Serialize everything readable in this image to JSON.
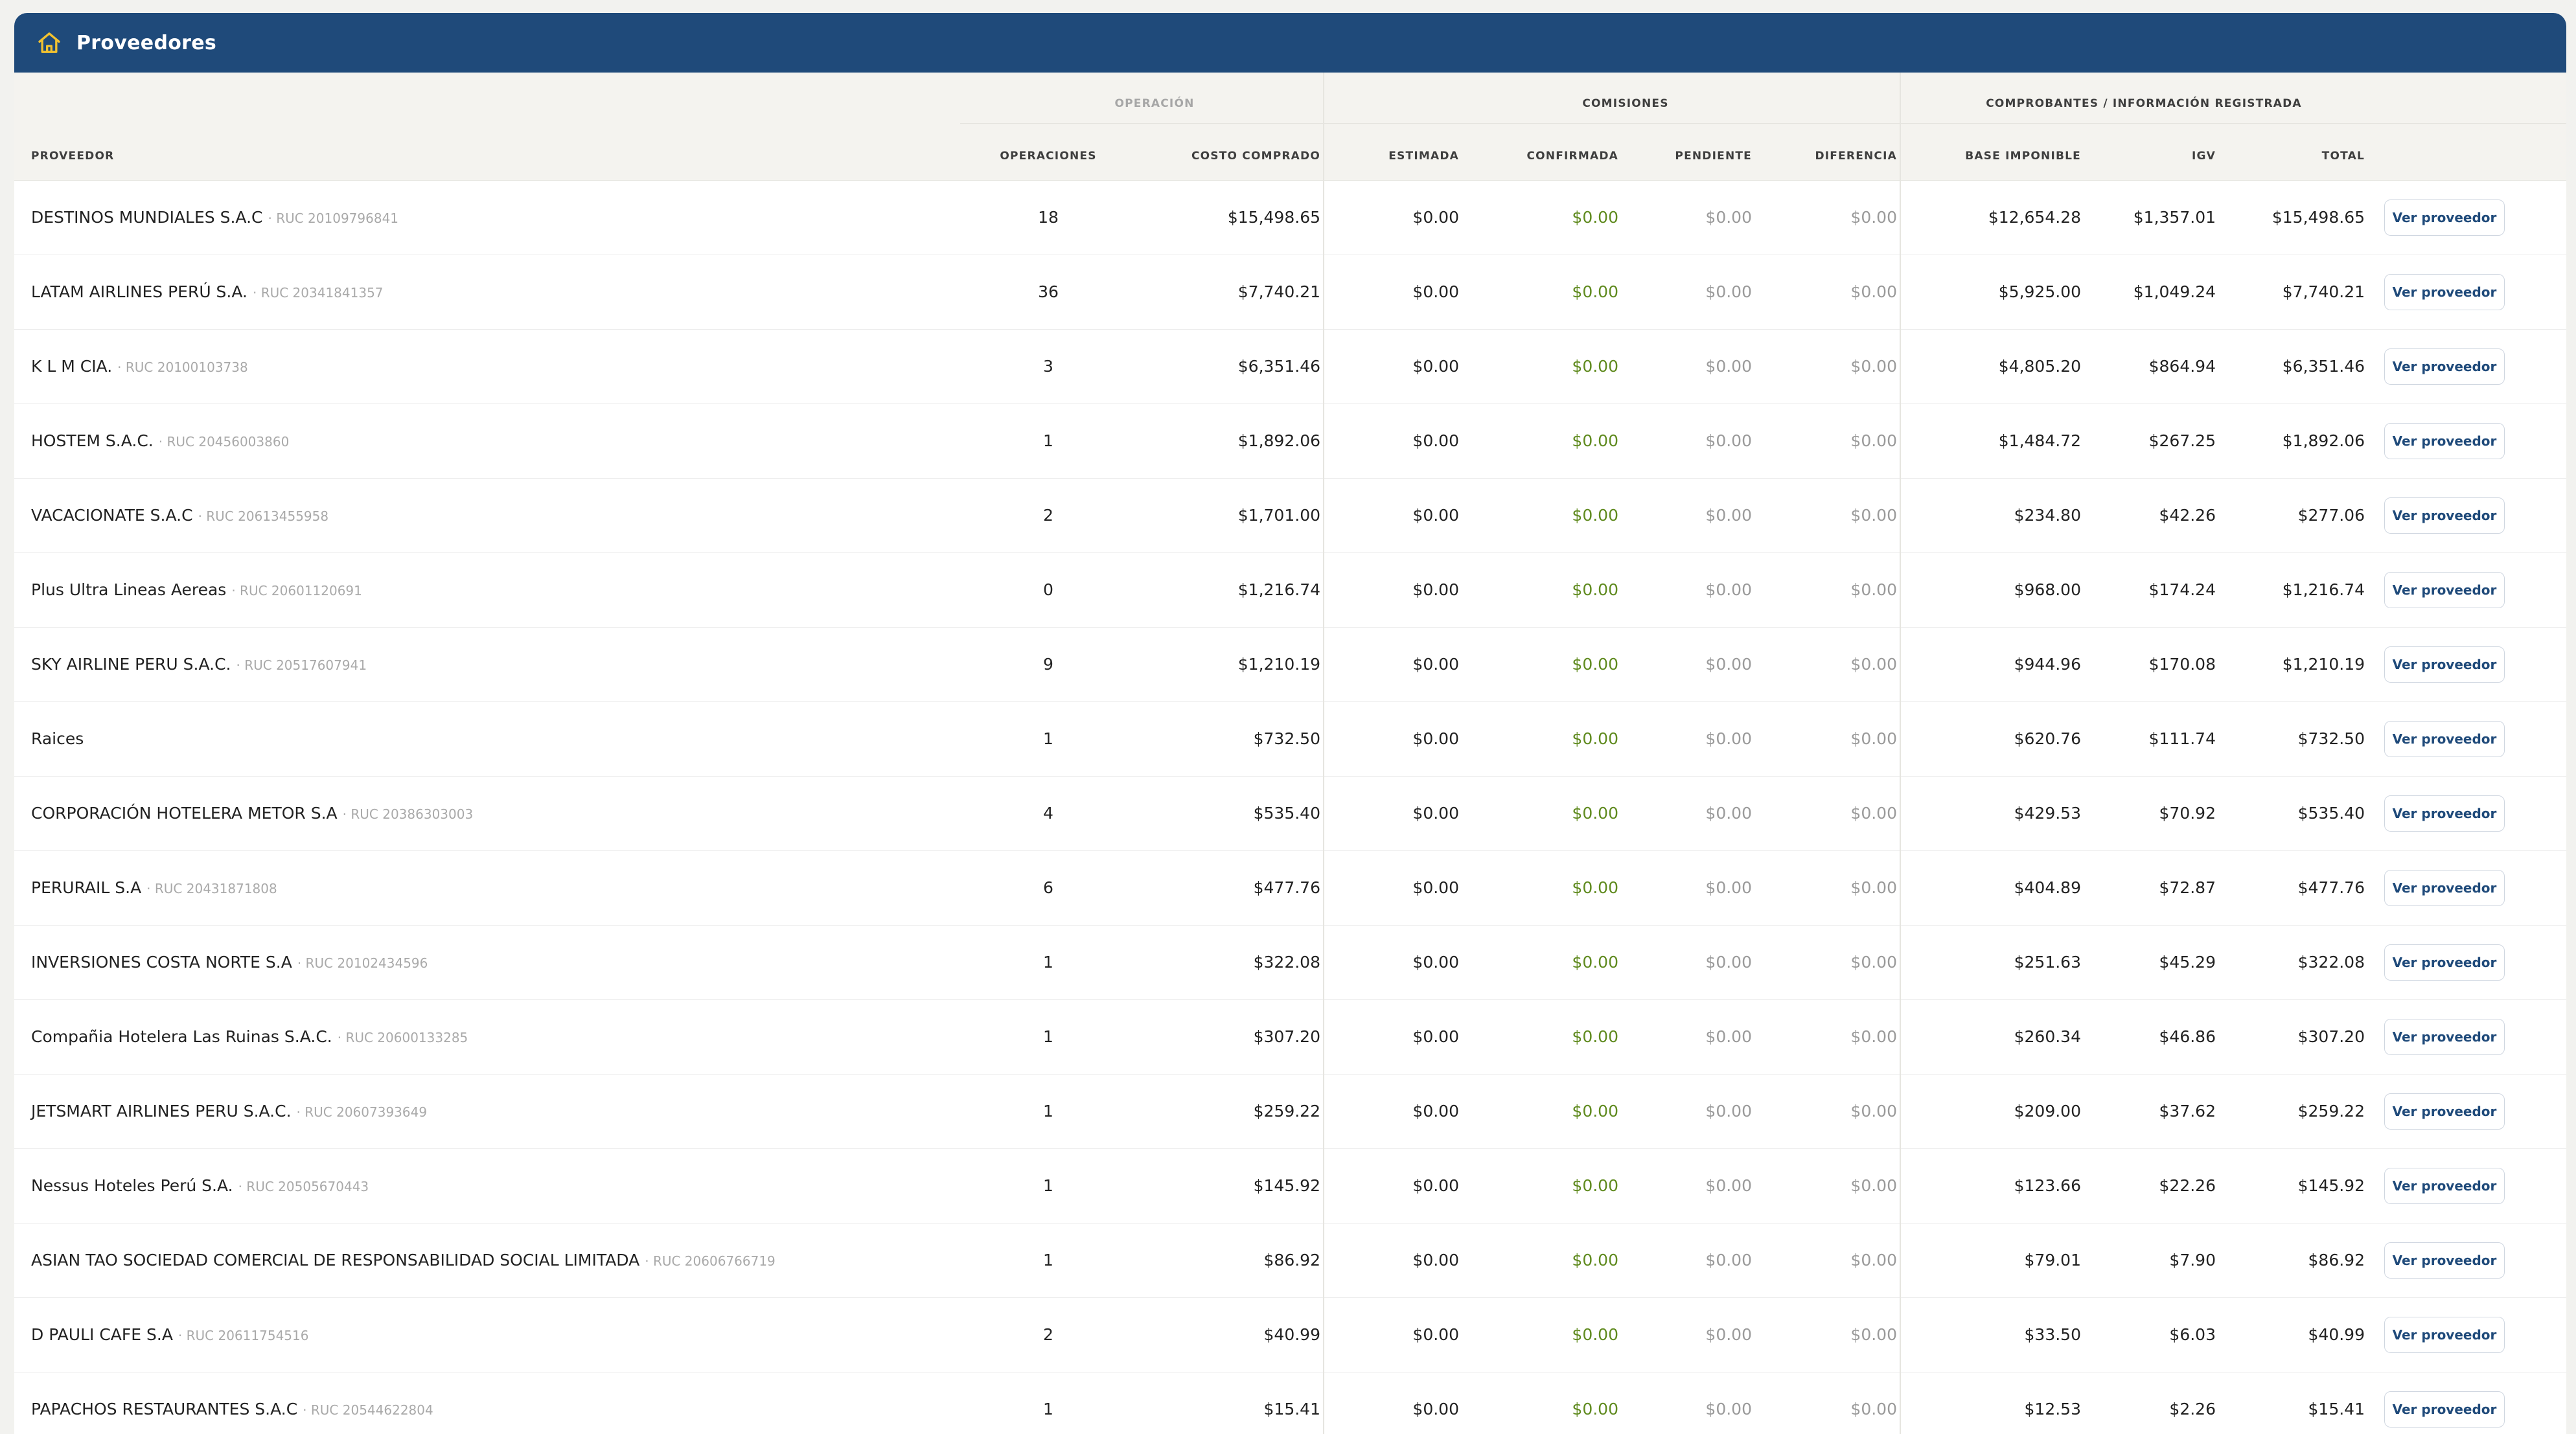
{
  "window": {
    "title": "Proveedores",
    "icon": "home-icon"
  },
  "header": {
    "groups": {
      "operacion": "OPERACIÓN",
      "comisiones": "COMISIONES",
      "comprobantes": "COMPROBANTES / INFORMACIÓN REGISTRADA"
    },
    "columns": {
      "proveedor": "PROVEEDOR",
      "operaciones": "OPERACIONES",
      "costo_comprado": "COSTO COMPRADO",
      "estimada": "ESTIMADA",
      "confirmada": "CONFIRMADA",
      "pendiente": "PENDIENTE",
      "diferencia": "DIFERENCIA",
      "base_imponible": "BASE IMPONIBLE",
      "igv": "IGV",
      "total": "TOTAL"
    }
  },
  "colors": {
    "header_bar": "#1f4a7a",
    "confirmada_green": "#5f8a1e",
    "muted_text": "#9a9a9a"
  },
  "action_label": "Ver proveedor",
  "rows": [
    {
      "name": "DESTINOS MUNDIALES S.A.C",
      "ruc": "· RUC 20109796841",
      "ops": "18",
      "costo": "$15,498.65",
      "estimada": "$0.00",
      "confirmada": "$0.00",
      "pendiente": "$0.00",
      "diferencia": "$0.00",
      "base": "$12,654.28",
      "igv": "$1,357.01",
      "total": "$15,498.65"
    },
    {
      "name": "LATAM AIRLINES PERÚ S.A.",
      "ruc": "· RUC 20341841357",
      "ops": "36",
      "costo": "$7,740.21",
      "estimada": "$0.00",
      "confirmada": "$0.00",
      "pendiente": "$0.00",
      "diferencia": "$0.00",
      "base": "$5,925.00",
      "igv": "$1,049.24",
      "total": "$7,740.21"
    },
    {
      "name": "K L M CIA.",
      "ruc": "· RUC 20100103738",
      "ops": "3",
      "costo": "$6,351.46",
      "estimada": "$0.00",
      "confirmada": "$0.00",
      "pendiente": "$0.00",
      "diferencia": "$0.00",
      "base": "$4,805.20",
      "igv": "$864.94",
      "total": "$6,351.46"
    },
    {
      "name": "HOSTEM S.A.C.",
      "ruc": "· RUC 20456003860",
      "ops": "1",
      "costo": "$1,892.06",
      "estimada": "$0.00",
      "confirmada": "$0.00",
      "pendiente": "$0.00",
      "diferencia": "$0.00",
      "base": "$1,484.72",
      "igv": "$267.25",
      "total": "$1,892.06"
    },
    {
      "name": "VACACIONATE S.A.C",
      "ruc": "· RUC 20613455958",
      "ops": "2",
      "costo": "$1,701.00",
      "estimada": "$0.00",
      "confirmada": "$0.00",
      "pendiente": "$0.00",
      "diferencia": "$0.00",
      "base": "$234.80",
      "igv": "$42.26",
      "total": "$277.06"
    },
    {
      "name": "Plus Ultra Lineas Aereas",
      "ruc": "· RUC 20601120691",
      "ops": "0",
      "costo": "$1,216.74",
      "estimada": "$0.00",
      "confirmada": "$0.00",
      "pendiente": "$0.00",
      "diferencia": "$0.00",
      "base": "$968.00",
      "igv": "$174.24",
      "total": "$1,216.74"
    },
    {
      "name": "SKY AIRLINE PERU S.A.C.",
      "ruc": "· RUC 20517607941",
      "ops": "9",
      "costo": "$1,210.19",
      "estimada": "$0.00",
      "confirmada": "$0.00",
      "pendiente": "$0.00",
      "diferencia": "$0.00",
      "base": "$944.96",
      "igv": "$170.08",
      "total": "$1,210.19"
    },
    {
      "name": "Raices",
      "ruc": "",
      "ops": "1",
      "costo": "$732.50",
      "estimada": "$0.00",
      "confirmada": "$0.00",
      "pendiente": "$0.00",
      "diferencia": "$0.00",
      "base": "$620.76",
      "igv": "$111.74",
      "total": "$732.50"
    },
    {
      "name": "CORPORACIÓN HOTELERA METOR S.A",
      "ruc": "· RUC 20386303003",
      "ops": "4",
      "costo": "$535.40",
      "estimada": "$0.00",
      "confirmada": "$0.00",
      "pendiente": "$0.00",
      "diferencia": "$0.00",
      "base": "$429.53",
      "igv": "$70.92",
      "total": "$535.40"
    },
    {
      "name": "PERURAIL S.A",
      "ruc": "· RUC 20431871808",
      "ops": "6",
      "costo": "$477.76",
      "estimada": "$0.00",
      "confirmada": "$0.00",
      "pendiente": "$0.00",
      "diferencia": "$0.00",
      "base": "$404.89",
      "igv": "$72.87",
      "total": "$477.76"
    },
    {
      "name": "INVERSIONES COSTA NORTE S.A",
      "ruc": "· RUC 20102434596",
      "ops": "1",
      "costo": "$322.08",
      "estimada": "$0.00",
      "confirmada": "$0.00",
      "pendiente": "$0.00",
      "diferencia": "$0.00",
      "base": "$251.63",
      "igv": "$45.29",
      "total": "$322.08"
    },
    {
      "name": "Compañia Hotelera Las Ruinas S.A.C.",
      "ruc": "· RUC 20600133285",
      "ops": "1",
      "costo": "$307.20",
      "estimada": "$0.00",
      "confirmada": "$0.00",
      "pendiente": "$0.00",
      "diferencia": "$0.00",
      "base": "$260.34",
      "igv": "$46.86",
      "total": "$307.20"
    },
    {
      "name": "JETSMART AIRLINES PERU S.A.C.",
      "ruc": "· RUC 20607393649",
      "ops": "1",
      "costo": "$259.22",
      "estimada": "$0.00",
      "confirmada": "$0.00",
      "pendiente": "$0.00",
      "diferencia": "$0.00",
      "base": "$209.00",
      "igv": "$37.62",
      "total": "$259.22"
    },
    {
      "name": "Nessus Hoteles Perú S.A.",
      "ruc": "· RUC 20505670443",
      "ops": "1",
      "costo": "$145.92",
      "estimada": "$0.00",
      "confirmada": "$0.00",
      "pendiente": "$0.00",
      "diferencia": "$0.00",
      "base": "$123.66",
      "igv": "$22.26",
      "total": "$145.92"
    },
    {
      "name": "ASIAN TAO SOCIEDAD COMERCIAL DE RESPONSABILIDAD SOCIAL LIMITADA",
      "ruc": "· RUC 20606766719",
      "ops": "1",
      "costo": "$86.92",
      "estimada": "$0.00",
      "confirmada": "$0.00",
      "pendiente": "$0.00",
      "diferencia": "$0.00",
      "base": "$79.01",
      "igv": "$7.90",
      "total": "$86.92"
    },
    {
      "name": "D PAULI CAFE S.A",
      "ruc": "· RUC 20611754516",
      "ops": "2",
      "costo": "$40.99",
      "estimada": "$0.00",
      "confirmada": "$0.00",
      "pendiente": "$0.00",
      "diferencia": "$0.00",
      "base": "$33.50",
      "igv": "$6.03",
      "total": "$40.99"
    },
    {
      "name": "PAPACHOS RESTAURANTES S.A.C",
      "ruc": "· RUC 20544622804",
      "ops": "1",
      "costo": "$15.41",
      "estimada": "$0.00",
      "confirmada": "$0.00",
      "pendiente": "$0.00",
      "diferencia": "$0.00",
      "base": "$12.53",
      "igv": "$2.26",
      "total": "$15.41"
    }
  ]
}
